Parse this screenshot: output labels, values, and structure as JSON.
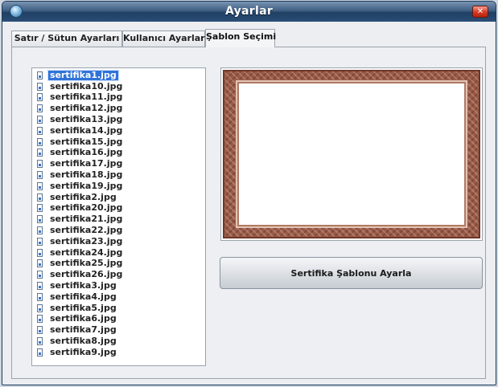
{
  "window": {
    "title": "Ayarlar",
    "close_symbol": "✕"
  },
  "tabs": [
    {
      "label": "Satır / Sütun Ayarları"
    },
    {
      "label": "Kullanıcı Ayarları"
    },
    {
      "label": "Şablon Seçimi",
      "active": true
    }
  ],
  "file_list": {
    "items": [
      {
        "name": "sertifika1.jpg",
        "selected": true
      },
      {
        "name": "sertifika10.jpg"
      },
      {
        "name": "sertifika11.jpg"
      },
      {
        "name": "sertifika12.jpg"
      },
      {
        "name": "sertifika13.jpg"
      },
      {
        "name": "sertifika14.jpg"
      },
      {
        "name": "sertifika15.jpg"
      },
      {
        "name": "sertifika16.jpg"
      },
      {
        "name": "sertifika17.jpg"
      },
      {
        "name": "sertifika18.jpg"
      },
      {
        "name": "sertifika19.jpg"
      },
      {
        "name": "sertifika2.jpg"
      },
      {
        "name": "sertifika20.jpg"
      },
      {
        "name": "sertifika21.jpg"
      },
      {
        "name": "sertifika22.jpg"
      },
      {
        "name": "sertifika23.jpg"
      },
      {
        "name": "sertifika24.jpg"
      },
      {
        "name": "sertifika25.jpg"
      },
      {
        "name": "sertifika26.jpg"
      },
      {
        "name": "sertifika3.jpg"
      },
      {
        "name": "sertifika4.jpg"
      },
      {
        "name": "sertifika5.jpg"
      },
      {
        "name": "sertifika6.jpg"
      },
      {
        "name": "sertifika7.jpg"
      },
      {
        "name": "sertifika8.jpg"
      },
      {
        "name": "sertifika9.jpg"
      }
    ],
    "icon": "image-file-icon"
  },
  "preview": {
    "frame_color": "#9a5a48"
  },
  "action_button": {
    "label": "Sertifika Şablonu Ayarla"
  },
  "colors": {
    "selection": "#2f73d8",
    "titlebar": "#2c4e76"
  }
}
